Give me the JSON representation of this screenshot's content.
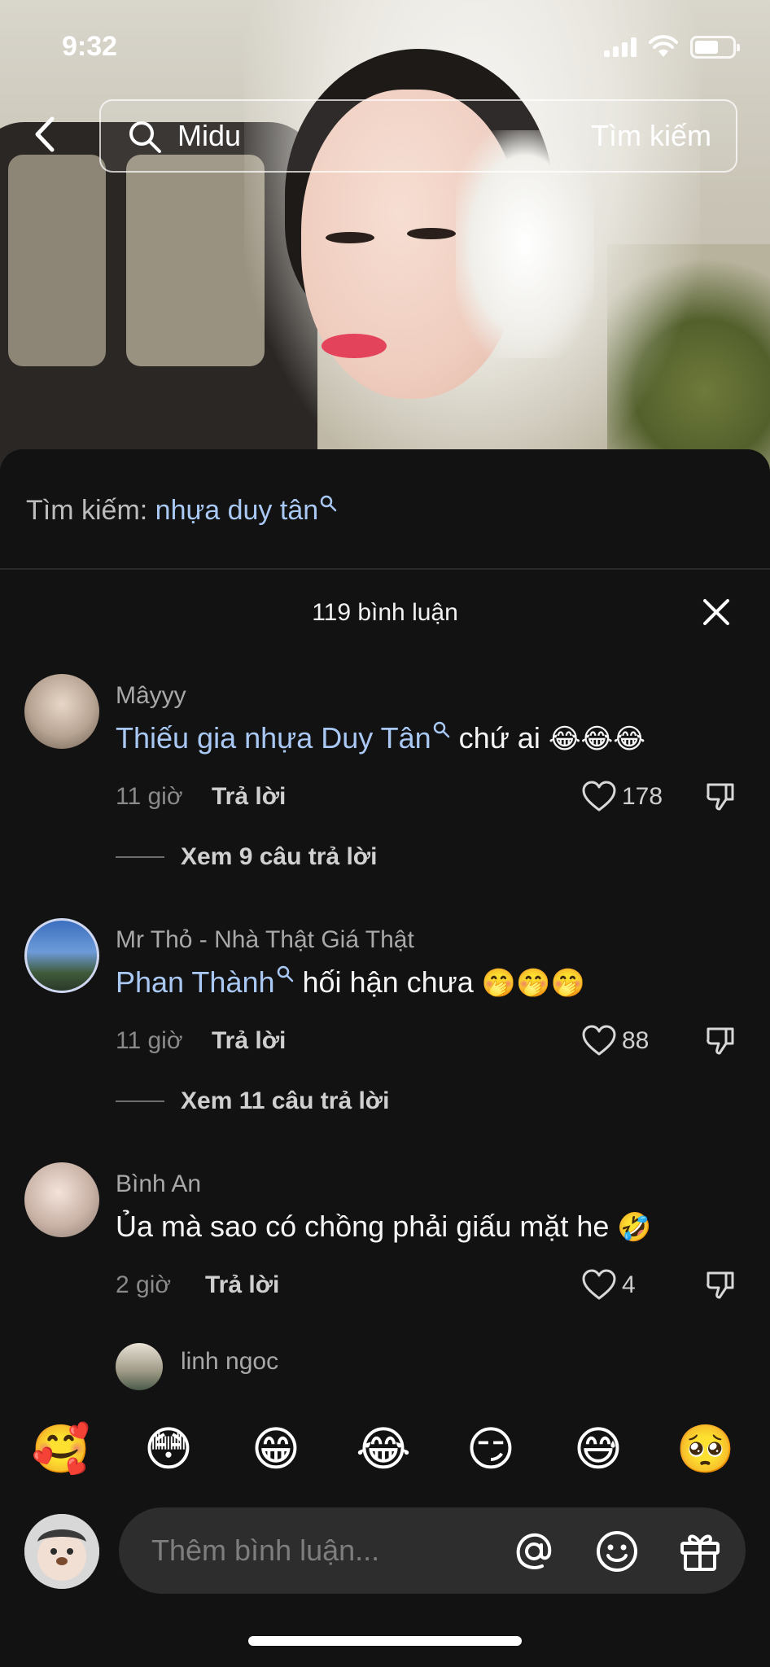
{
  "status_bar": {
    "time": "9:32"
  },
  "header": {
    "query": "Midu",
    "submit_label": "Tìm kiếm"
  },
  "sheet": {
    "search_prefix": "Tìm kiếm:",
    "search_keyword": "nhựa duy tân",
    "comment_count": "119 bình luận"
  },
  "comments": [
    {
      "user": "Mâyyy",
      "link": "Thiếu gia nhựa Duy Tân",
      "text": " chứ ai ",
      "emoji": "😂😂😂",
      "time": "11 giờ",
      "reply_label": "Trả lời",
      "likes": "178",
      "view_replies": "Xem 9 câu trả lời"
    },
    {
      "user": "Mr Thỏ - Nhà Thật Giá Thật",
      "link": "Phan Thành",
      "text": " hối hận chưa ",
      "emoji": "🤭🤭🤭",
      "time": "11 giờ",
      "reply_label": "Trả lời",
      "likes": "88",
      "view_replies": "Xem 11 câu trả lời"
    },
    {
      "user": "Bình An",
      "text": "Ủa mà sao có chồng phải giấu mặt he ",
      "emoji": "🤣",
      "time": "2 giờ",
      "reply_label": "Trả lời",
      "likes": "4"
    }
  ],
  "reply_preview": {
    "user": "linh ngoc"
  },
  "emoji_bar": [
    "🥰",
    "😳",
    "😁",
    "😂",
    "😏",
    "😅",
    "🥺"
  ],
  "input": {
    "placeholder": "Thêm bình luận..."
  },
  "colors": {
    "link": "#a9c8f4",
    "sheet_bg": "#121212",
    "input_bg": "#2d2d2d"
  }
}
